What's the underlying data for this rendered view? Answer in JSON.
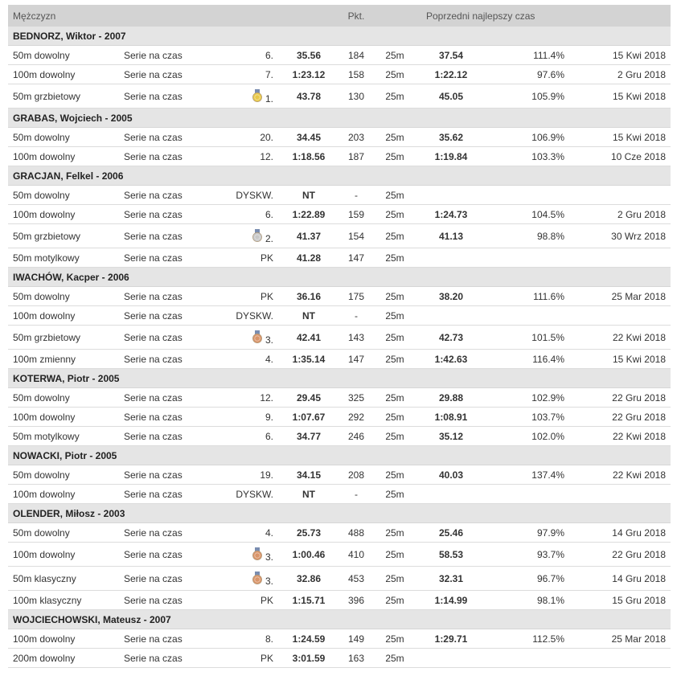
{
  "header": {
    "category": "Mężczyzn",
    "points": "Pkt.",
    "previous_best": "Poprzedni najlepszy czas"
  },
  "colors": {
    "header_bg": "#d3d3d3",
    "athlete_row_bg": "#e5e5e5",
    "medal_gold": "#e8c84a",
    "medal_silver": "#c8c8c8",
    "medal_bronze": "#d9956a"
  },
  "athletes": [
    {
      "name": "BEDNORZ, Wiktor - 2007",
      "results": [
        {
          "event": "50m dowolny",
          "round": "Serie na czas",
          "place": "6.",
          "time": "35.56",
          "points": "184",
          "pool": "25m",
          "pb": "37.54",
          "pct": "111.4%",
          "date": "15 Kwi 2018"
        },
        {
          "event": "100m dowolny",
          "round": "Serie na czas",
          "place": "7.",
          "time": "1:23.12",
          "points": "158",
          "pool": "25m",
          "pb": "1:22.12",
          "pct": "97.6%",
          "date": "2 Gru 2018"
        },
        {
          "event": "50m grzbietowy",
          "round": "Serie na czas",
          "place": "1.",
          "medal": "gold",
          "time": "43.78",
          "points": "130",
          "pool": "25m",
          "pb": "45.05",
          "pct": "105.9%",
          "date": "15 Kwi 2018"
        }
      ]
    },
    {
      "name": "GRABAS, Wojciech - 2005",
      "results": [
        {
          "event": "50m dowolny",
          "round": "Serie na czas",
          "place": "20.",
          "time": "34.45",
          "points": "203",
          "pool": "25m",
          "pb": "35.62",
          "pct": "106.9%",
          "date": "15 Kwi 2018"
        },
        {
          "event": "100m dowolny",
          "round": "Serie na czas",
          "place": "12.",
          "time": "1:18.56",
          "points": "187",
          "pool": "25m",
          "pb": "1:19.84",
          "pct": "103.3%",
          "date": "10 Cze 2018"
        }
      ]
    },
    {
      "name": "GRACJAN, Felkel - 2006",
      "results": [
        {
          "event": "50m dowolny",
          "round": "Serie na czas",
          "place": "DYSKW.",
          "time": "NT",
          "points": "-",
          "pool": "25m",
          "pb": "",
          "pct": "",
          "date": ""
        },
        {
          "event": "100m dowolny",
          "round": "Serie na czas",
          "place": "6.",
          "time": "1:22.89",
          "points": "159",
          "pool": "25m",
          "pb": "1:24.73",
          "pct": "104.5%",
          "date": "2 Gru 2018"
        },
        {
          "event": "50m grzbietowy",
          "round": "Serie na czas",
          "place": "2.",
          "medal": "silver",
          "time": "41.37",
          "points": "154",
          "pool": "25m",
          "pb": "41.13",
          "pct": "98.8%",
          "date": "30 Wrz 2018"
        },
        {
          "event": "50m motylkowy",
          "round": "Serie na czas",
          "place": "PK",
          "time": "41.28",
          "points": "147",
          "pool": "25m",
          "pb": "",
          "pct": "",
          "date": ""
        }
      ]
    },
    {
      "name": "IWACHÓW, Kacper - 2006",
      "results": [
        {
          "event": "50m dowolny",
          "round": "Serie na czas",
          "place": "PK",
          "time": "36.16",
          "points": "175",
          "pool": "25m",
          "pb": "38.20",
          "pct": "111.6%",
          "date": "25 Mar 2018"
        },
        {
          "event": "100m dowolny",
          "round": "Serie na czas",
          "place": "DYSKW.",
          "time": "NT",
          "points": "-",
          "pool": "25m",
          "pb": "",
          "pct": "",
          "date": ""
        },
        {
          "event": "50m grzbietowy",
          "round": "Serie na czas",
          "place": "3.",
          "medal": "bronze",
          "time": "42.41",
          "points": "143",
          "pool": "25m",
          "pb": "42.73",
          "pct": "101.5%",
          "date": "22 Kwi 2018"
        },
        {
          "event": "100m zmienny",
          "round": "Serie na czas",
          "place": "4.",
          "time": "1:35.14",
          "points": "147",
          "pool": "25m",
          "pb": "1:42.63",
          "pct": "116.4%",
          "date": "15 Kwi 2018"
        }
      ]
    },
    {
      "name": "KOTERWA, Piotr - 2005",
      "results": [
        {
          "event": "50m dowolny",
          "round": "Serie na czas",
          "place": "12.",
          "time": "29.45",
          "points": "325",
          "pool": "25m",
          "pb": "29.88",
          "pct": "102.9%",
          "date": "22 Gru 2018"
        },
        {
          "event": "100m dowolny",
          "round": "Serie na czas",
          "place": "9.",
          "time": "1:07.67",
          "points": "292",
          "pool": "25m",
          "pb": "1:08.91",
          "pct": "103.7%",
          "date": "22 Gru 2018"
        },
        {
          "event": "50m motylkowy",
          "round": "Serie na czas",
          "place": "6.",
          "time": "34.77",
          "points": "246",
          "pool": "25m",
          "pb": "35.12",
          "pct": "102.0%",
          "date": "22 Kwi 2018"
        }
      ]
    },
    {
      "name": "NOWACKI, Piotr - 2005",
      "results": [
        {
          "event": "50m dowolny",
          "round": "Serie na czas",
          "place": "19.",
          "time": "34.15",
          "points": "208",
          "pool": "25m",
          "pb": "40.03",
          "pct": "137.4%",
          "date": "22 Kwi 2018"
        },
        {
          "event": "100m dowolny",
          "round": "Serie na czas",
          "place": "DYSKW.",
          "time": "NT",
          "points": "-",
          "pool": "25m",
          "pb": "",
          "pct": "",
          "date": ""
        }
      ]
    },
    {
      "name": "OLENDER, Miłosz - 2003",
      "results": [
        {
          "event": "50m dowolny",
          "round": "Serie na czas",
          "place": "4.",
          "time": "25.73",
          "points": "488",
          "pool": "25m",
          "pb": "25.46",
          "pct": "97.9%",
          "date": "14 Gru 2018"
        },
        {
          "event": "100m dowolny",
          "round": "Serie na czas",
          "place": "3.",
          "medal": "bronze",
          "time": "1:00.46",
          "points": "410",
          "pool": "25m",
          "pb": "58.53",
          "pct": "93.7%",
          "date": "22 Gru 2018"
        },
        {
          "event": "50m klasyczny",
          "round": "Serie na czas",
          "place": "3.",
          "medal": "bronze",
          "time": "32.86",
          "points": "453",
          "pool": "25m",
          "pb": "32.31",
          "pct": "96.7%",
          "date": "14 Gru 2018"
        },
        {
          "event": "100m klasyczny",
          "round": "Serie na czas",
          "place": "PK",
          "time": "1:15.71",
          "points": "396",
          "pool": "25m",
          "pb": "1:14.99",
          "pct": "98.1%",
          "date": "15 Gru 2018"
        }
      ]
    },
    {
      "name": "WOJCIECHOWSKI, Mateusz - 2007",
      "results": [
        {
          "event": "100m dowolny",
          "round": "Serie na czas",
          "place": "8.",
          "time": "1:24.59",
          "points": "149",
          "pool": "25m",
          "pb": "1:29.71",
          "pct": "112.5%",
          "date": "25 Mar 2018"
        },
        {
          "event": "200m dowolny",
          "round": "Serie na czas",
          "place": "PK",
          "time": "3:01.59",
          "points": "163",
          "pool": "25m",
          "pb": "",
          "pct": "",
          "date": ""
        }
      ]
    }
  ]
}
